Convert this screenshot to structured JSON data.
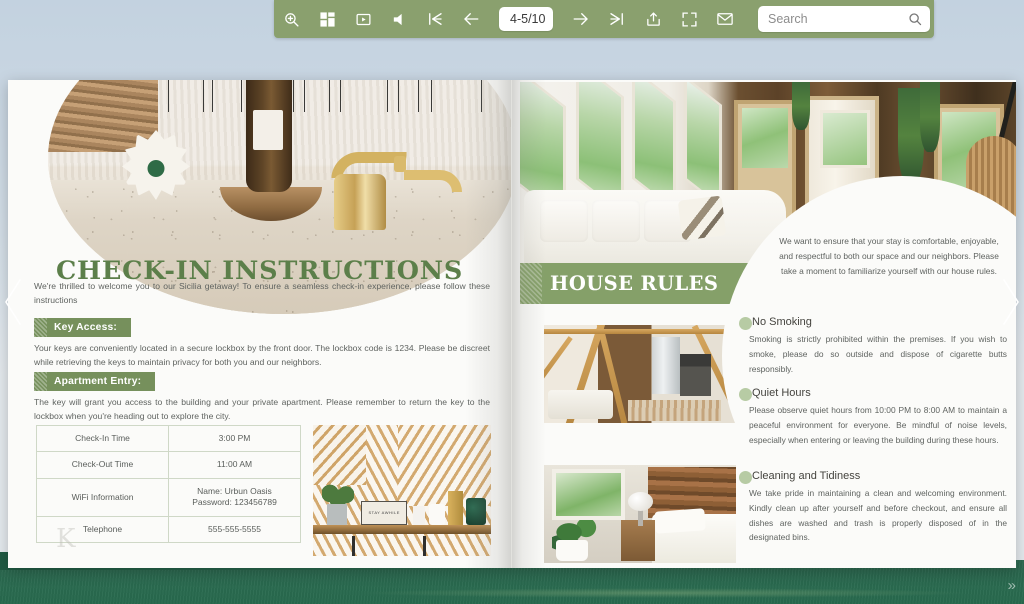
{
  "toolbar": {
    "buttons": [
      {
        "name": "zoom-in-icon",
        "title": "Zoom In"
      },
      {
        "name": "thumbnails-icon",
        "title": "Thumbnails"
      },
      {
        "name": "presentation-icon",
        "title": "Presentation Mode"
      },
      {
        "name": "sound-icon",
        "title": "Sound"
      },
      {
        "name": "first-page-icon",
        "title": "First Page"
      },
      {
        "name": "previous-page-icon",
        "title": "Previous Page"
      }
    ],
    "buttons_right": [
      {
        "name": "next-page-icon",
        "title": "Next Page"
      },
      {
        "name": "last-page-icon",
        "title": "Last Page"
      },
      {
        "name": "share-icon",
        "title": "Share"
      },
      {
        "name": "fullscreen-icon",
        "title": "Fullscreen"
      },
      {
        "name": "email-icon",
        "title": "Email"
      }
    ],
    "page_indicator": "4-5/10",
    "search_placeholder": "Search",
    "search_value": "",
    "background_color": "#8aa06e"
  },
  "left_page": {
    "title": "CHECK-IN INSTRUCTIONS",
    "intro": "We're thrilled to welcome you to our Sicilia getaway! To ensure a seamless check-in experience, please follow these instructions",
    "sections": [
      {
        "tag": "Key Access:",
        "body": "Your keys are conveniently located in a secure lockbox by the front door. The lockbox code is 1234. Please be discreet while retrieving the keys to maintain privacy for both you and our neighbors."
      },
      {
        "tag": "Apartment Entry:",
        "body": "The key will grant you access to the building and your private apartment. Please remember to return the key to the lockbox when you're heading out to explore the city."
      }
    ],
    "table": [
      {
        "label": "Check-In Time",
        "value": "3:00 PM"
      },
      {
        "label": "Check-Out Time",
        "value": "11:00 AM"
      },
      {
        "label": "WiFi Information",
        "value": "Name: Urbun Oasis\nPassword: 123456789"
      },
      {
        "label": "Telephone",
        "value": "555-555-5555"
      }
    ],
    "photo_caption": "STAY AWHILE"
  },
  "right_page": {
    "banner_title": "HOUSE RULES",
    "intro": "We want to ensure that your stay is comfortable, enjoyable, and respectful to both our space and our neighbors. Please take a moment to familiarize yourself with our house rules.",
    "rules": [
      {
        "heading": "No Smoking",
        "text": "Smoking is strictly prohibited within the premises. If you wish to smoke, please do so outside and dispose of cigarette butts responsibly."
      },
      {
        "heading": "Quiet Hours",
        "text": "Please observe quiet hours from 10:00 PM to 8:00 AM to maintain a peaceful environment for everyone. Be mindful of noise levels, especially when entering or leaving the building during these hours."
      },
      {
        "heading": "Cleaning and Tidiness",
        "text": "We take pride in maintaining a clean and welcoming environment. Kindly clean up after yourself and before checkout, and ensure all dishes are washed and trash is properly disposed of in the designated bins."
      }
    ]
  },
  "watermark": "K",
  "colors": {
    "toolbar_green": "#8aa06e",
    "banner_green": "#85a069",
    "tag_green": "#76905c",
    "title_green": "#5c7f4a",
    "bullet_green": "#b7cba4",
    "body_text": "#5f6360",
    "grass_green": "#2b6950",
    "sky_blue": "#ccd8e3"
  }
}
